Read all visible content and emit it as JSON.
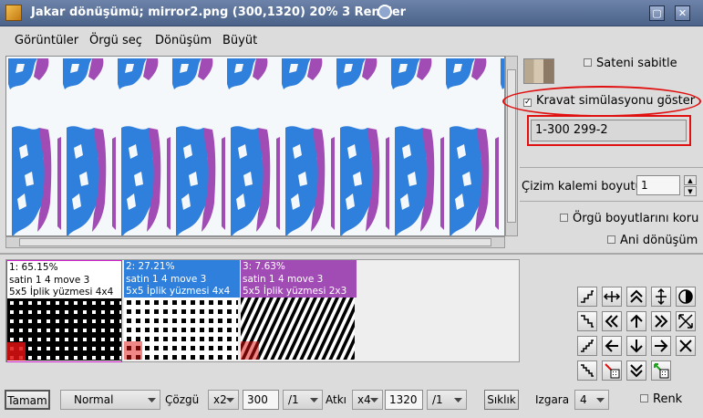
{
  "window": {
    "title": "Jakar dönüşümü; mirror2.png (300,1320) 20% 3 Renkler"
  },
  "menu": [
    "Görüntüler",
    "Örgü seç",
    "Dönüşüm",
    "Büyüt"
  ],
  "right_panel": {
    "saten_sabitle": "Sateni sabitle",
    "kravat": "Kravat simülasyonu göster",
    "kravat_checked": true,
    "kravat_value": "1-300 299-2",
    "cizim_label": "Çizim kalemi boyutu",
    "cizim_value": "1",
    "orgu_boyut": "Örgü boyutlarını koru",
    "ani_donusum": "Ani dönüşüm"
  },
  "weaves": [
    {
      "line1": "1: 65.15%",
      "line2": "satin 1 4 move 3",
      "line3": "5x5 İplik yüzmesi 4x4",
      "header_bg": "#ffffff",
      "header_fg": "#000000",
      "border": "#d020d0"
    },
    {
      "line1": "2: 27.21%",
      "line2": "satin 1 4 move 3",
      "line3": "5x5 İplik yüzmesi 4x4",
      "header_bg": "#2f80dc",
      "header_fg": "#ffffff",
      "border": "#2f80dc"
    },
    {
      "line1": "3: 7.63%",
      "line2": "satin 1 4 move 3",
      "line3": "5x5 İplik yüzmesi 2x3",
      "header_bg": "#a04cb4",
      "header_fg": "#ffffff",
      "border": "#a04cb4"
    }
  ],
  "tools": [
    "step-up-icon",
    "arrows-horizontal-icon",
    "double-up-icon",
    "arrows-vertical-icon",
    "half-contrast-icon",
    "step-down-icon",
    "double-left-icon",
    "arrow-up-icon",
    "double-right-icon",
    "expand-diagonal-icon",
    "step-right-icon",
    "arrow-left-icon",
    "arrow-down-icon",
    "arrow-right-icon",
    "close-x-icon",
    "step-left-icon",
    "delete-grid-icon",
    "double-down-icon",
    "add-grid-icon"
  ],
  "bottom": {
    "tamam": "Tamam",
    "mode": "Normal",
    "cozgu_label": "Çözgü",
    "cozgu_mult": "x2",
    "cozgu_value": "300",
    "cozgu_div": "/1",
    "atki_label": "Atkı",
    "atki_mult": "x4",
    "atki_value": "1320",
    "atki_div": "/1",
    "siklik": "Sıklık",
    "izgara_label": "Izgara",
    "izgara_value": "4",
    "renk": "Renk"
  },
  "colors": {
    "blue": "#2f80dc",
    "purple": "#a04cb4",
    "highlight": "#e01010"
  }
}
